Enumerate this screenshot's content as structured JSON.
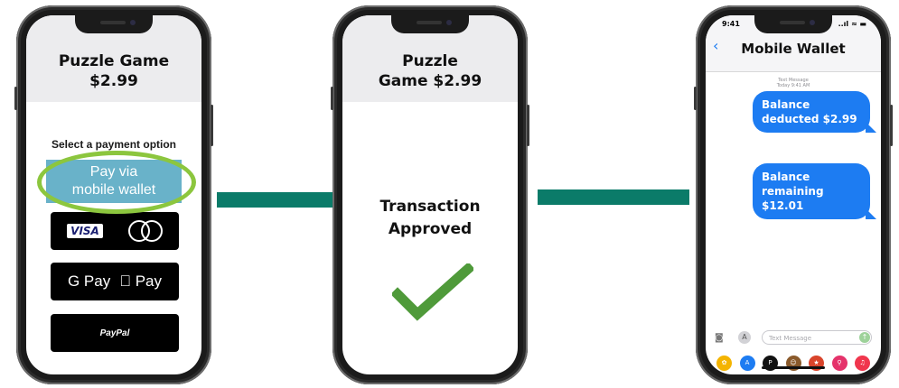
{
  "phone1": {
    "title_line1": "Puzzle Game",
    "title_line2": "$2.99",
    "select_label": "Select a payment option",
    "wallet_line1": "Pay via",
    "wallet_line2": "mobile wallet",
    "visa": "VISA",
    "gpay": "G Pay",
    "apay": " Pay",
    "paypal": "PayPal"
  },
  "phone2": {
    "title_line1": "Puzzle",
    "title_line2": "Game $2.99",
    "status_line1": "Transaction",
    "status_line2": "Approved"
  },
  "phone3": {
    "time": "9:41",
    "signal": "..ıl ≈ ▬",
    "back_icon": "‹",
    "contact": "Mobile Wallet",
    "meta_line1": "Text Message",
    "meta_line2": "Today 9:41 AM",
    "bubbles": [
      {
        "line1": "Balance",
        "line2": "deducted $2.99"
      },
      {
        "line1": "Balance",
        "line2": "remaining $12.01"
      }
    ],
    "input_placeholder": "Text Message"
  },
  "colors": {
    "connector": "#0b7b69",
    "wallet_button": "#69b2c9",
    "highlight_ring": "#8cc63e",
    "checkmark": "#4f9a3a",
    "bubble": "#1d7cf2"
  }
}
